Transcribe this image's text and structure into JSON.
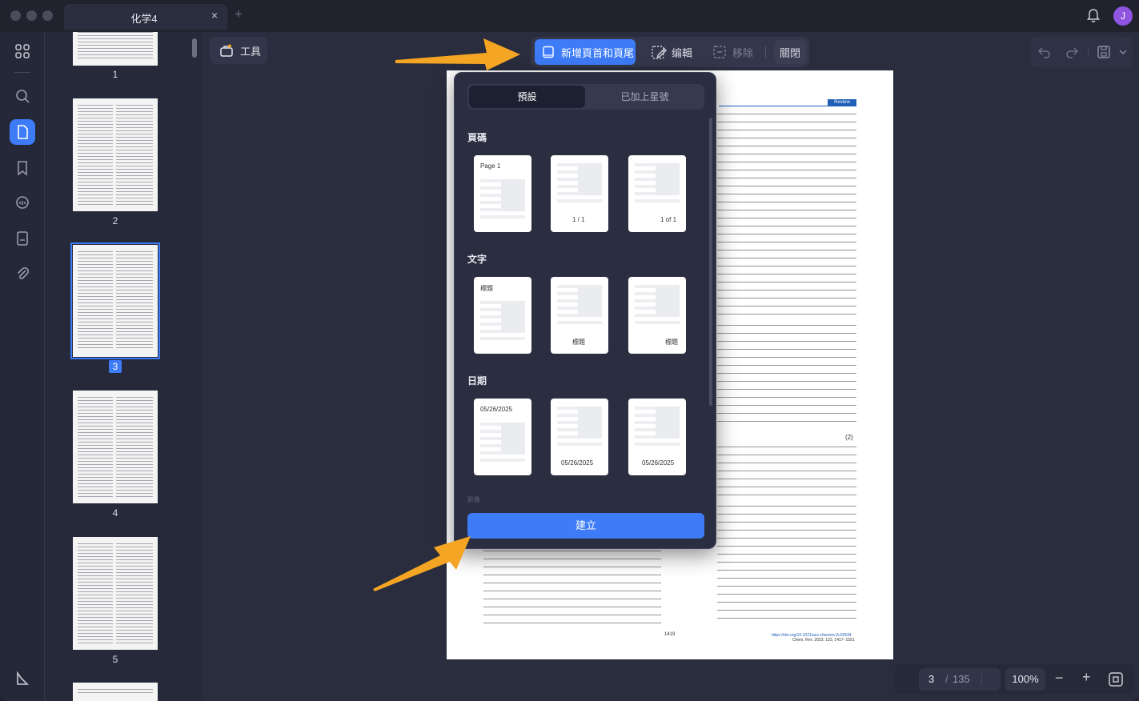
{
  "window": {
    "tab_title": "化学4",
    "tab_close": "×",
    "tab_add": "+",
    "avatar_initial": "J"
  },
  "thumbnails": [
    {
      "label": "1"
    },
    {
      "label": "2"
    },
    {
      "label": "3",
      "selected": true
    },
    {
      "label": "4"
    },
    {
      "label": "5"
    }
  ],
  "toolbar": {
    "tools_label": "工具",
    "add_header_footer_label": "新增頁首和頁尾",
    "edit_label": "编輯",
    "remove_label": "移除",
    "close_label": "關閉"
  },
  "popover": {
    "tabs": {
      "default": "預設",
      "starred": "已加上星號"
    },
    "sections": {
      "page_number": {
        "title": "頁碼",
        "cards": [
          "Page 1",
          "1 / 1",
          "1 of 1"
        ]
      },
      "text": {
        "title": "文字",
        "cards": [
          "標題",
          "標題",
          "標題"
        ]
      },
      "date": {
        "title": "日期",
        "cards": [
          "05/26/2025",
          "05/26/2025",
          "05/26/2025"
        ]
      }
    },
    "next_section_faded": "影像",
    "create_button": "建立"
  },
  "document": {
    "review_tag": "Review",
    "page_number_footer": "1419",
    "equation_number": "(2)",
    "footer_doi": "https://doi.org/10.1021/acs.chemrev.2c00534",
    "footer_journal": "Chem. Rev. 2023, 123, 1417−1551"
  },
  "status": {
    "current_page": "3",
    "separator": "/",
    "total_pages": "135",
    "zoom": "100%",
    "zoom_out": "−",
    "zoom_in": "+"
  },
  "colors": {
    "accent": "#3d7bf7",
    "arrow": "#f5a524",
    "avatar": "#8f55e0"
  }
}
